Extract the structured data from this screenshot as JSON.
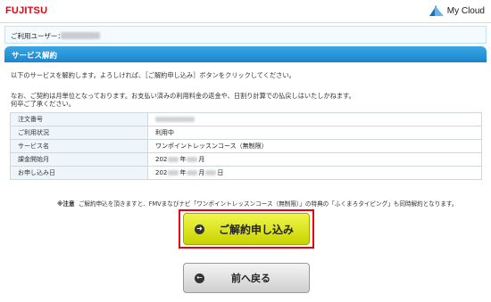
{
  "header": {
    "brand": "FUJITSU",
    "service": "My Cloud"
  },
  "user": {
    "label": "ご利用ユーザー："
  },
  "section": {
    "title": "サービス解約"
  },
  "intro": {
    "line1": "以下のサービスを解約します。よろしければ、［ご解約申し込み］ボタンをクリックしてください。",
    "line2": "なお、ご契約は月単位となっております。お支払い済みの利用料金の返金や、日割り計算での払戻しはいたしかねます。",
    "line3": "何卒ご了承ください。"
  },
  "details": {
    "order_no_label": "注文番号",
    "status_label": "ご利用状況",
    "status_value": "利用中",
    "service_label": "サービス名",
    "service_value": "ワンポイントレッスンコース（無制限）",
    "billing_start_label": "課金開始月",
    "billing_start_year": "202",
    "billing_start_month_unit": "年",
    "billing_start_tail": "月",
    "apply_date_label": "お申し込み日",
    "apply_year": "202",
    "apply_year_unit": "年",
    "apply_month_unit": "月",
    "apply_day_unit": "日"
  },
  "note": {
    "prefix": "※注意",
    "text": "ご解約申込を頂きますと、FMVまなびナビ「ワンポイントレッスンコース（無制限）」の特典の「ふくまろタイピング」も同時解約となります。"
  },
  "buttons": {
    "apply": "ご解約申し込み",
    "back": "前へ戻る",
    "apply_icon": "arrow-right-icon",
    "back_icon": "arrow-left-icon"
  },
  "colors": {
    "brand_red": "#e60012",
    "header_blue": "#1a86cf",
    "apply_yellow": "#d6e000"
  }
}
